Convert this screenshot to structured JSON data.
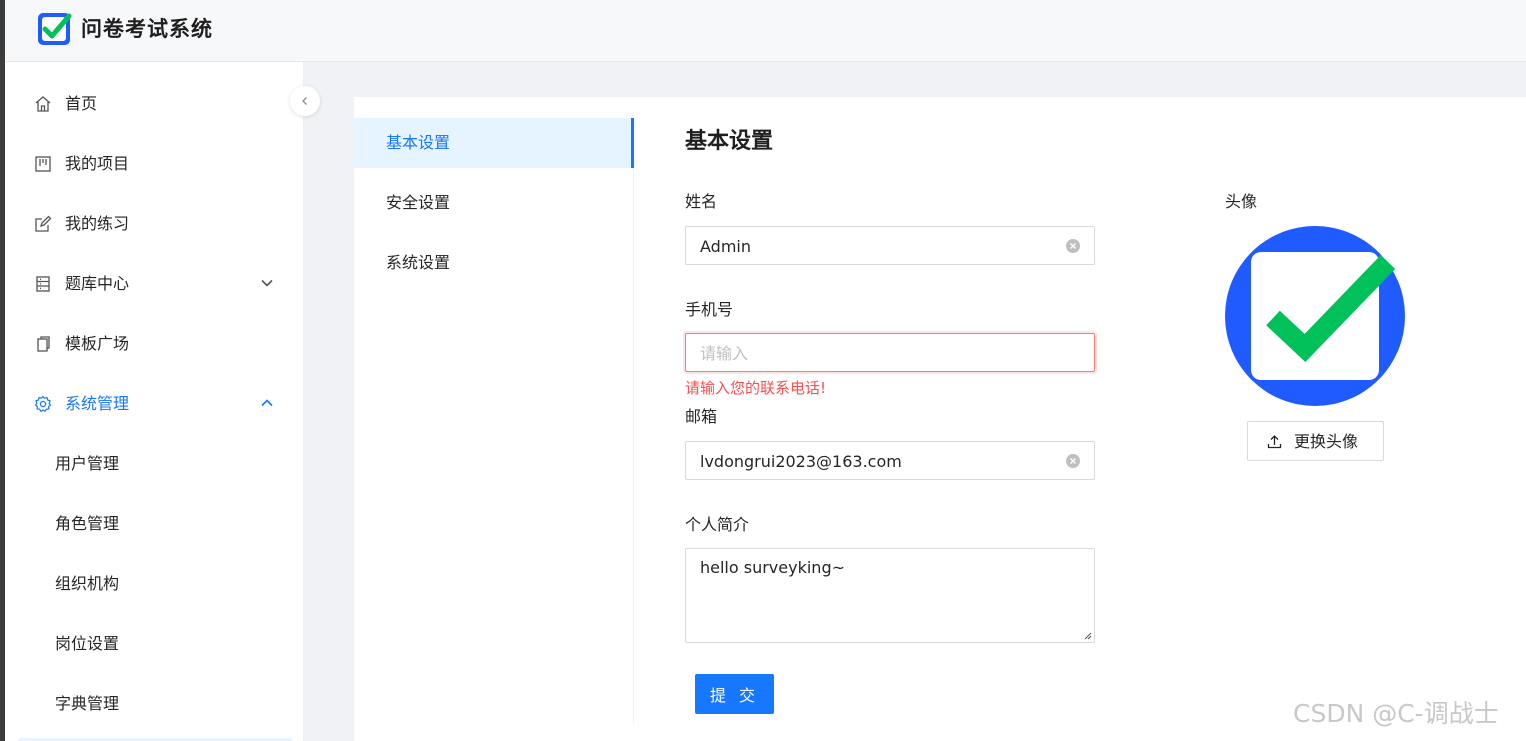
{
  "app": {
    "title": "问卷考试系统"
  },
  "sidebar": {
    "items": [
      {
        "label": "首页",
        "icon": "home-icon"
      },
      {
        "label": "我的项目",
        "icon": "project-icon"
      },
      {
        "label": "我的练习",
        "icon": "edit-icon"
      },
      {
        "label": "题库中心",
        "icon": "database-icon"
      },
      {
        "label": "模板广场",
        "icon": "copy-icon"
      },
      {
        "label": "系统管理",
        "icon": "gear-icon"
      }
    ],
    "sub_items": [
      "用户管理",
      "角色管理",
      "组织机构",
      "岗位设置",
      "字典管理"
    ]
  },
  "settings_nav": [
    "基本设置",
    "安全设置",
    "系统设置"
  ],
  "form": {
    "title": "基本设置",
    "name": {
      "label": "姓名",
      "value": "Admin"
    },
    "phone": {
      "label": "手机号",
      "value": "",
      "placeholder": "请输入",
      "error": "请输入您的联系电话!"
    },
    "email": {
      "label": "邮箱",
      "value": "lvdongrui2023@163.com"
    },
    "bio": {
      "label": "个人简介",
      "value": "hello surveyking~"
    },
    "submit_label": "提 交"
  },
  "avatar": {
    "label": "头像",
    "upload_label": "更换头像"
  },
  "watermark": "CSDN @C-调战士",
  "colors": {
    "primary": "#1677ff",
    "error": "#ff4d4f",
    "avatar_bg": "#1f5bff",
    "check": "#00c05a"
  }
}
